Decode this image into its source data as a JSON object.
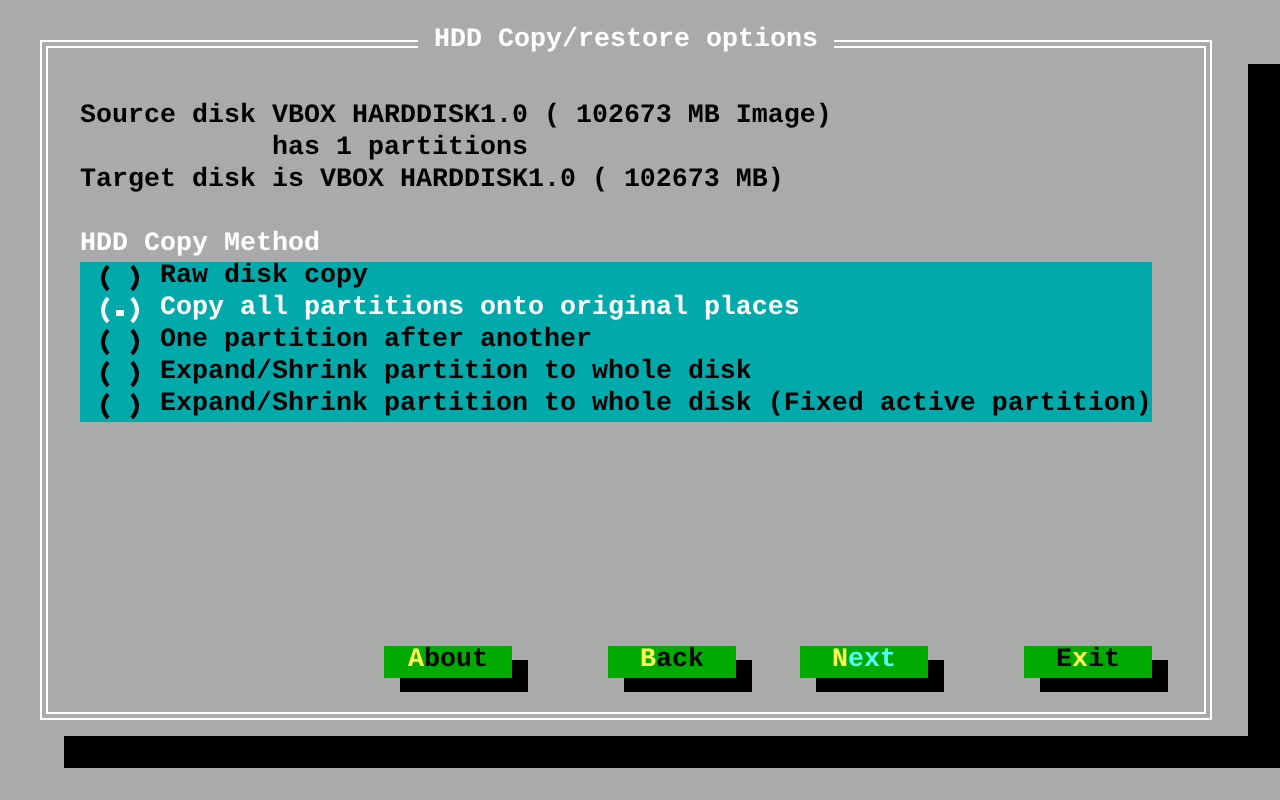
{
  "dialog": {
    "title": "HDD Copy/restore options",
    "info_lines": [
      "Source disk VBOX HARDDISK1.0 ( 102673 MB Image)",
      "has 1 partitions",
      "Target disk is VBOX HARDDISK1.0 ( 102673 MB)"
    ],
    "method": {
      "label": "HDD Copy Method",
      "options": [
        {
          "label": "Raw disk copy",
          "selected": false
        },
        {
          "label": "Copy all partitions onto original places",
          "selected": true
        },
        {
          "label": "One partition after another",
          "selected": false
        },
        {
          "label": "Expand/Shrink partition to whole disk",
          "selected": false
        },
        {
          "label": "Expand/Shrink partition to whole disk (Fixed active partition)",
          "selected": false
        }
      ]
    },
    "buttons": [
      {
        "hotkey": "A",
        "after": "bout",
        "focused": false
      },
      {
        "hotkey": "B",
        "after": "ack",
        "focused": false
      },
      {
        "hotkey": "N",
        "after": "ext",
        "focused": true
      },
      {
        "before": "E",
        "hotkey": "x",
        "after": "it",
        "focused": false
      }
    ]
  }
}
